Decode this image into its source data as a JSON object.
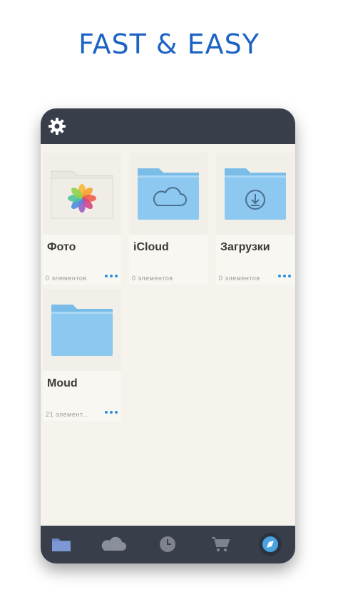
{
  "headline": "FAST & EASY",
  "files": [
    {
      "name": "Фото",
      "count": "0 элементов",
      "icon": "photos-icon"
    },
    {
      "name": "iCloud",
      "count": "0 элементов",
      "icon": "icloud-folder-icon"
    },
    {
      "name": "Загрузки",
      "count": "0 элементов",
      "icon": "downloads-folder-icon"
    },
    {
      "name": "Moud",
      "count": "21 элемент...",
      "icon": "folder-icon"
    }
  ],
  "colors": {
    "accent": "#1c63c4",
    "bar": "#383e4a",
    "folder": "#8cc8ef",
    "active_nav": "#4aa3e0"
  },
  "bottom_nav": [
    "files-icon",
    "cloud-icon",
    "recent-icon",
    "cart-icon",
    "compass-icon"
  ]
}
